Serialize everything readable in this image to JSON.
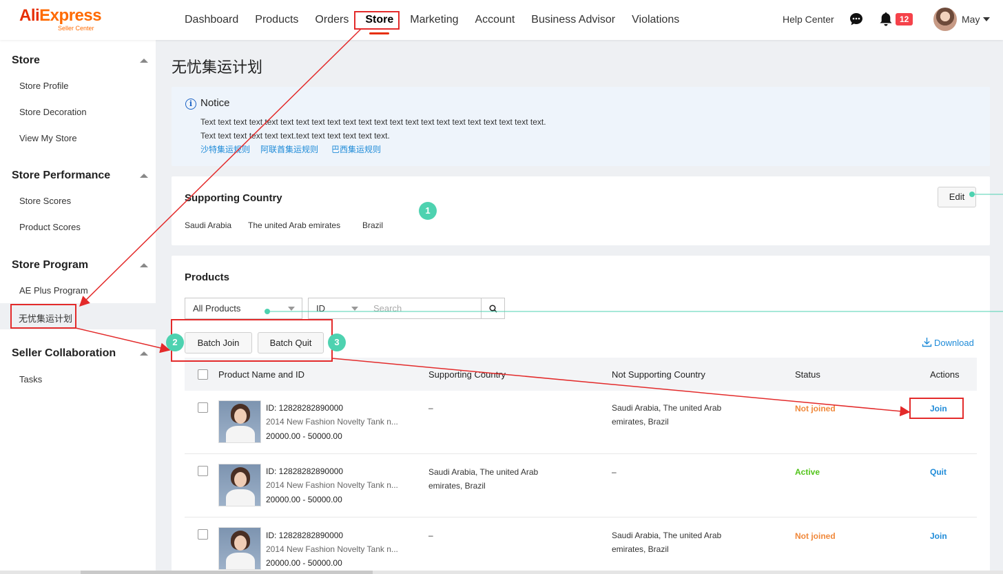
{
  "header": {
    "logo_main": "AliExpress",
    "logo_sub": "Seller Center",
    "nav": [
      "Dashboard",
      "Products",
      "Orders",
      "Store",
      "Marketing",
      "Account",
      "Business Advisor",
      "Violations"
    ],
    "active_nav": "Store",
    "help": "Help Center",
    "notification_count": "12",
    "user": "May"
  },
  "sidebar": {
    "groups": [
      {
        "title": "Store",
        "items": [
          "Store Profile",
          "Store Decoration",
          "View My Store"
        ]
      },
      {
        "title": "Store Performance",
        "items": [
          "Store Scores",
          "Product Scores"
        ]
      },
      {
        "title": "Store Program",
        "items": [
          "AE Plus Program",
          "无忧集运计划"
        ]
      },
      {
        "title": "Seller Collaboration",
        "items": [
          "Tasks"
        ]
      }
    ],
    "selected": "无忧集运计划"
  },
  "page": {
    "title": "无忧集运计划",
    "notice": {
      "title": "Notice",
      "line1": "Text text text text text text text text text text text text text text text text text text text text text text.",
      "line2": "Text text text text text text.text text text text text text.",
      "links": [
        "沙特集运规则",
        "阿联酋集运规则",
        "巴西集运规则"
      ]
    },
    "supporting": {
      "title": "Supporting Country",
      "countries": [
        "Saudi Arabia",
        "The united Arab emirates",
        "Brazil"
      ],
      "edit": "Edit"
    },
    "products": {
      "title": "Products",
      "filter_selected": "All Products",
      "id_selected": "ID",
      "search_placeholder": "Search",
      "batch_join": "Batch Join",
      "batch_quit": "Batch Quit",
      "download": "Download",
      "columns": [
        "Product Name and ID",
        "Supporting Country",
        "Not Supporting Country",
        "Status",
        "Actions"
      ],
      "rows": [
        {
          "id": "ID: 12828282890000",
          "name": "2014 New Fashion Novelty Tank n...",
          "price": "20000.00 - 50000.00",
          "supporting": "–",
          "not_supporting": "Saudi Arabia, The united Arab emirates, Brazil",
          "status": "Not joined",
          "action": "Join"
        },
        {
          "id": "ID: 12828282890000",
          "name": "2014 New Fashion Novelty Tank n...",
          "price": "20000.00 - 50000.00",
          "supporting": "Saudi Arabia, The united Arab emirates, Brazil",
          "not_supporting": "–",
          "status": "Active",
          "action": "Quit"
        },
        {
          "id": "ID: 12828282890000",
          "name": "2014 New Fashion Novelty Tank n...",
          "price": "20000.00 - 50000.00",
          "supporting": "–",
          "not_supporting": "Saudi Arabia, The united Arab emirates, Brazil",
          "status": "Not joined",
          "action": "Join"
        }
      ]
    }
  },
  "annotations": {
    "markers": [
      "1",
      "2",
      "3"
    ]
  },
  "colors": {
    "brand": "#e62e04",
    "link": "#1f8bd8",
    "status_not_joined": "#f0883a",
    "status_active": "#52c41a",
    "annotation_red": "#e32a2a",
    "annotation_green": "#4ed2b0"
  }
}
